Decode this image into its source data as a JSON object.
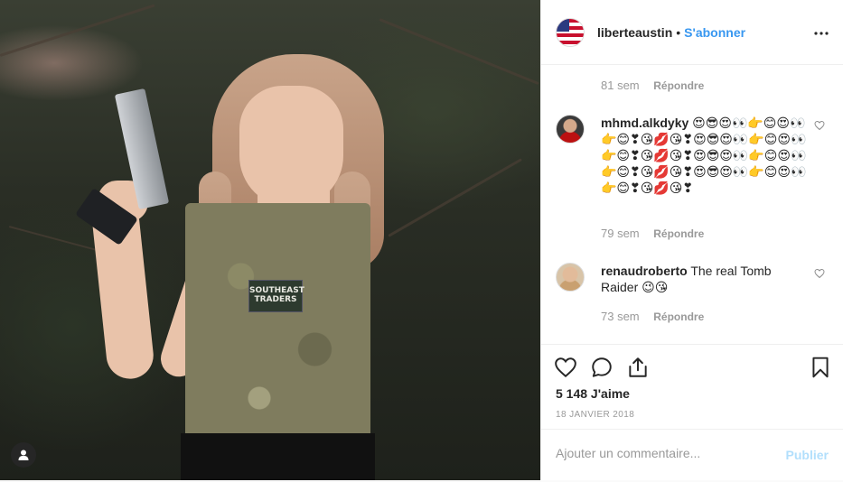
{
  "post": {
    "username": "liberteaustin",
    "separator": "•",
    "follow_label": "S'abonner",
    "more_icon": "more-icon",
    "image_patch_text_line1": "SOUTHEAST",
    "image_patch_text_line2": "TRADERS"
  },
  "comments": [
    {
      "username": "",
      "text": "",
      "time": "81 sem",
      "reply_label": "Répondre"
    },
    {
      "username": "mhmd.alkdyky",
      "text": "😍😎😍👀👉😊😍👀👉😊❣😘💋😘❣😍😎😍👀👉😊😍👀👉😊❣😘💋😘❣😍😎😍👀👉😊😍👀👉😊❣😘💋😘❣😍😎😍👀👉😊😍👀👉😊❣😘💋😘❣",
      "time": "79 sem",
      "reply_label": "Répondre"
    },
    {
      "username": "renaudroberto",
      "text": "The real Tomb Raider 😉😘",
      "time": "73 sem",
      "reply_label": "Répondre"
    }
  ],
  "actions": {
    "like_icon": "heart-icon",
    "comment_icon": "comment-icon",
    "share_icon": "share-icon",
    "save_icon": "bookmark-icon",
    "likes_text": "5 148 J'aime",
    "date_text": "18 JANVIER 2018"
  },
  "add_comment": {
    "placeholder": "Ajouter un commentaire...",
    "publish_label": "Publier"
  },
  "colors": {
    "link_blue": "#3897f0",
    "publish_disabled": "#b2dffc",
    "meta_gray": "#999999"
  }
}
